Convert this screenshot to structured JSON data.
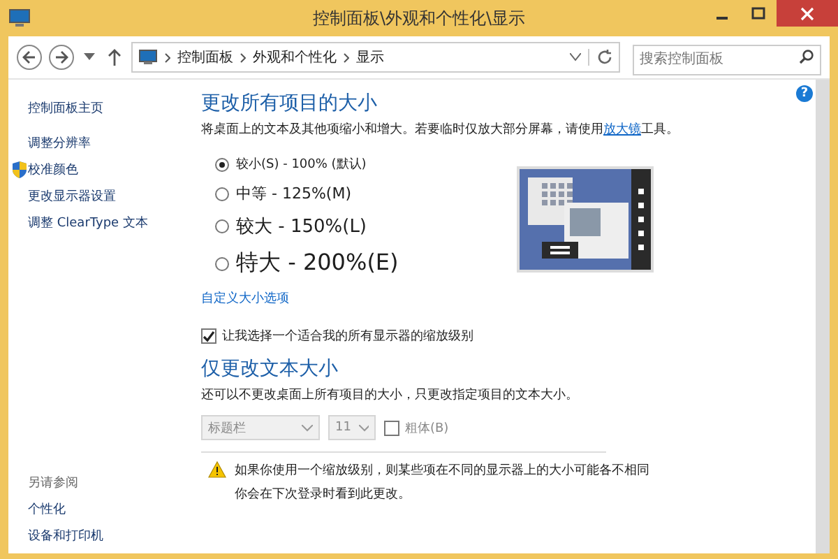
{
  "window": {
    "title": "控制面板\\外观和个性化\\显示"
  },
  "address_bar": {
    "crumbs": [
      "控制面板",
      "外观和个性化",
      "显示"
    ]
  },
  "search": {
    "placeholder": "搜索控制面板"
  },
  "sidebar": {
    "home": "控制面板主页",
    "items": [
      {
        "label": "调整分辨率",
        "shield": false
      },
      {
        "label": "校准颜色",
        "shield": true
      },
      {
        "label": "更改显示器设置",
        "shield": false
      },
      {
        "label": "调整 ClearType 文本",
        "shield": false
      }
    ],
    "see_also": "另请参阅",
    "links": [
      "个性化",
      "设备和打印机"
    ]
  },
  "main": {
    "help_icon": "?",
    "heading": "更改所有项目的大小",
    "description": {
      "before": "将桌面上的文本及其他项缩小和增大。若要临时仅放大部分屏幕，请使用",
      "link": "放大镜",
      "after": "工具。"
    },
    "options": [
      {
        "label": "较小(S) - 100% (默认)",
        "selected": true
      },
      {
        "label": "中等 - 125%(M)",
        "selected": false
      },
      {
        "label": "较大 - 150%(L)",
        "selected": false
      },
      {
        "label": "特大 - 200%(E)",
        "selected": false
      }
    ],
    "custom_link": "自定义大小选项",
    "per_display": {
      "label": "让我选择一个适合我的所有显示器的缩放级别",
      "checked": true
    },
    "text_heading": "仅更改文本大小",
    "text_description": "还可以不更改桌面上所有项目的大小，只更改指定项目的文本大小。",
    "item_select": {
      "value": "标题栏",
      "disabled": true
    },
    "size_select": {
      "value": "11",
      "disabled": true
    },
    "bold": {
      "label": "粗体(B)",
      "checked": false,
      "disabled": true
    },
    "warning": [
      "如果你使用一个缩放级别，则某些项在不同的显示器上的大小可能各不相同",
      "你会在下次登录时看到此更改。"
    ]
  }
}
